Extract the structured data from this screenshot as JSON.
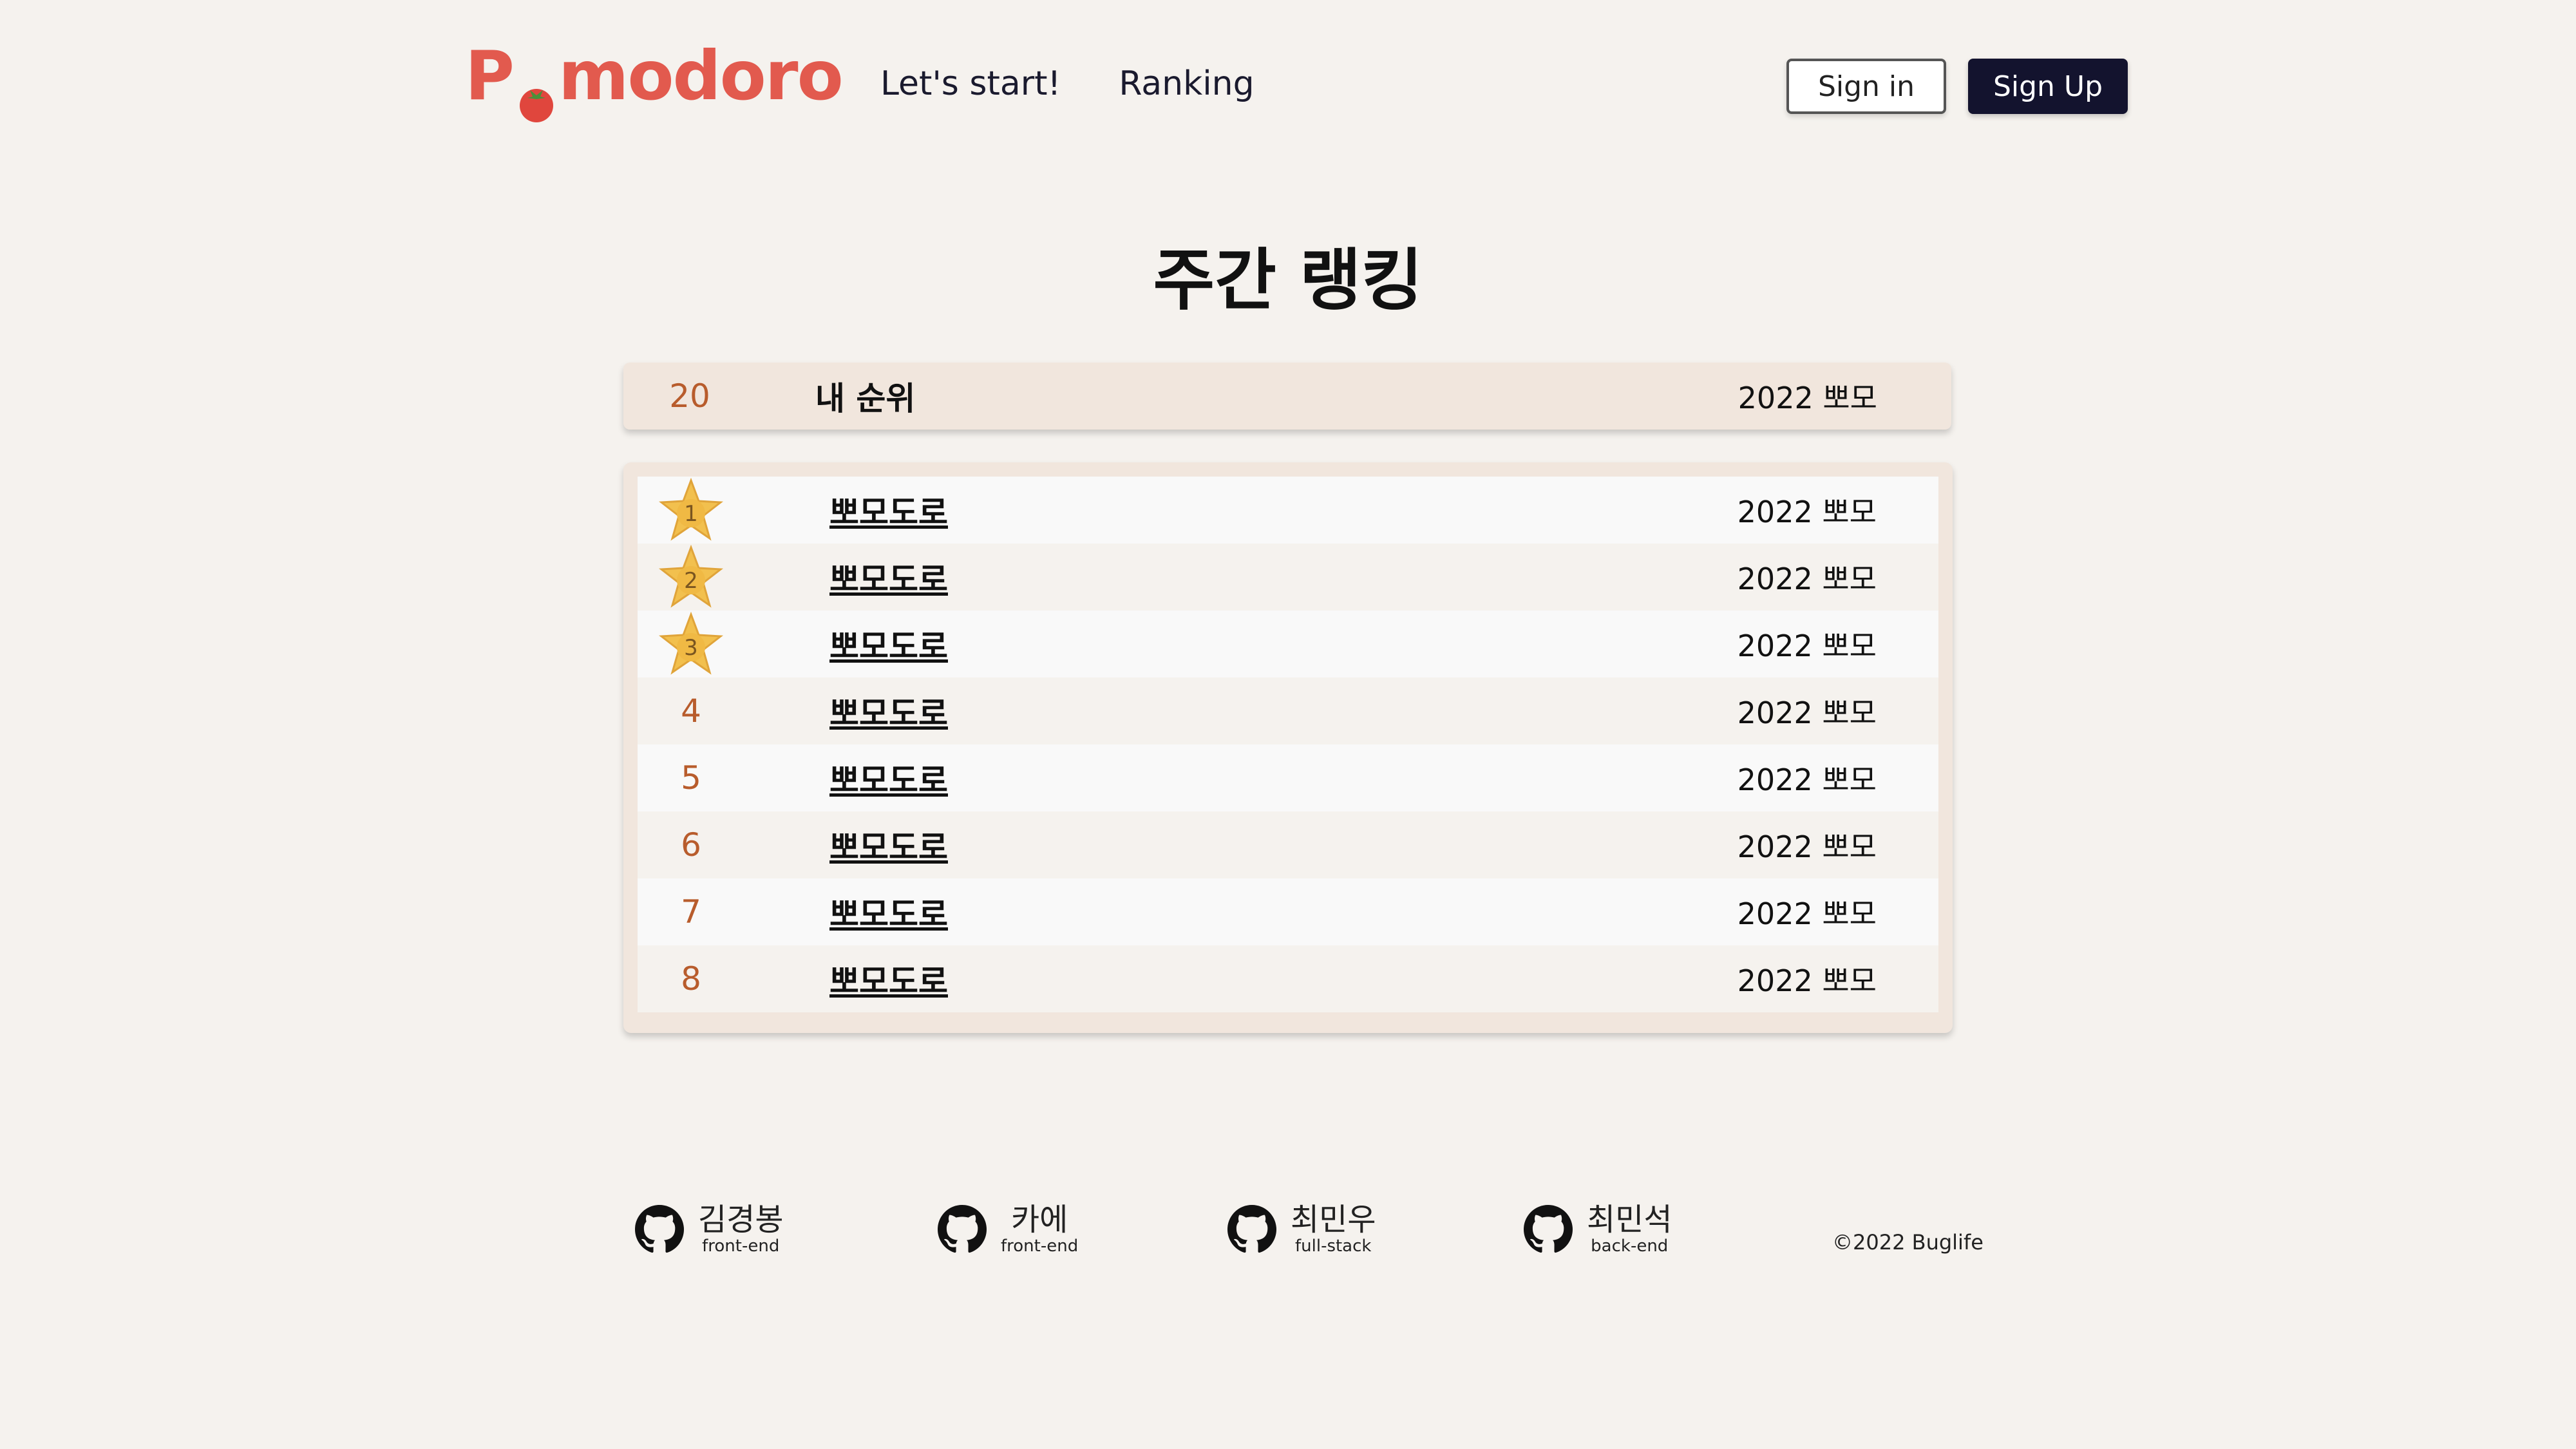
{
  "header": {
    "logo_prefix": "P",
    "logo_suffix": "modoro",
    "nav": [
      "Let's start!",
      "Ranking"
    ],
    "sign_in": "Sign in",
    "sign_up": "Sign Up"
  },
  "page_title": "주간 랭킹",
  "my_rank": {
    "rank": "20",
    "label": "내 순위",
    "score": "2022 뽀모"
  },
  "ranking": [
    {
      "rank": "1",
      "name": "뽀모도로",
      "score": "2022 뽀모"
    },
    {
      "rank": "2",
      "name": "뽀모도로",
      "score": "2022 뽀모"
    },
    {
      "rank": "3",
      "name": "뽀모도로",
      "score": "2022 뽀모"
    },
    {
      "rank": "4",
      "name": "뽀모도로",
      "score": "2022 뽀모"
    },
    {
      "rank": "5",
      "name": "뽀모도로",
      "score": "2022 뽀모"
    },
    {
      "rank": "6",
      "name": "뽀모도로",
      "score": "2022 뽀모"
    },
    {
      "rank": "7",
      "name": "뽀모도로",
      "score": "2022 뽀모"
    },
    {
      "rank": "8",
      "name": "뽀모도로",
      "score": "2022 뽀모"
    }
  ],
  "footer": {
    "members": [
      {
        "name": "김경봉",
        "role": "front-end"
      },
      {
        "name": "카에",
        "role": "front-end"
      },
      {
        "name": "최민우",
        "role": "full-stack"
      },
      {
        "name": "최민석",
        "role": "back-end"
      }
    ],
    "copyright": "©2022 Buglife"
  },
  "colors": {
    "brand": "#e25a4e",
    "rank_accent": "#b85c2c",
    "star": "#f2c04e",
    "dark_button": "#13132e"
  },
  "icons": {
    "tomato": "tomato-icon",
    "star": "star-icon",
    "github": "github-icon"
  }
}
